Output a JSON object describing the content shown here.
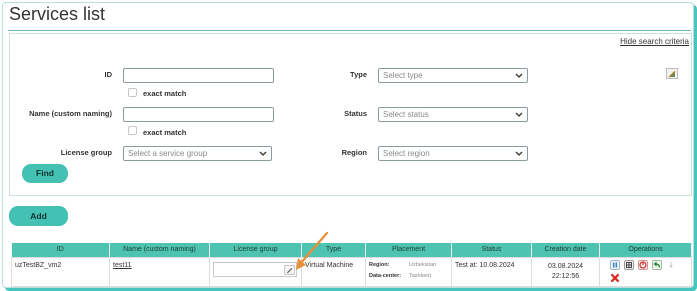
{
  "page": {
    "title": "Services list"
  },
  "search": {
    "hide_link": "Hide search criteria",
    "id_label": "ID",
    "id_value": "",
    "exact_match_label": "exact match",
    "name_label": "Name (custom naming)",
    "name_value": "",
    "license_group_label": "License group",
    "license_group_placeholder": "Select a service group",
    "type_label": "Type",
    "type_placeholder": "Select type",
    "status_label": "Status",
    "status_placeholder": "Select status",
    "region_label": "Region",
    "region_placeholder": "Select region",
    "find_button": "Find"
  },
  "actions": {
    "add_button": "Add"
  },
  "table": {
    "headers": [
      "ID",
      "Name (custom naming)",
      "License group",
      "Type",
      "Placement",
      "Status",
      "Creation date",
      "Operations"
    ],
    "rows": [
      {
        "id": "uzTestBZ_vm2",
        "name": "test11",
        "license_group": "",
        "type": "Virtual Machine",
        "placement": {
          "region_label": "Region:",
          "region_value": "Uzbekistan",
          "dc_label": "Data-center:",
          "dc_value": "Tashkent"
        },
        "status": "Test at: 10.08.2024",
        "creation_date": "03.08.2024",
        "creation_time": "22:12:56"
      }
    ]
  },
  "icons": {
    "corner": "column-settings-icon",
    "edit": "pencil-icon",
    "operations": [
      "pause-icon",
      "console-icon",
      "stop-icon",
      "return-icon",
      "disabled-icon",
      "delete-icon"
    ]
  },
  "colors": {
    "accent": "#45c1b4",
    "header": "#4ec3b1",
    "annotation_arrow": "#e8913a",
    "delete": "#d9261c"
  }
}
